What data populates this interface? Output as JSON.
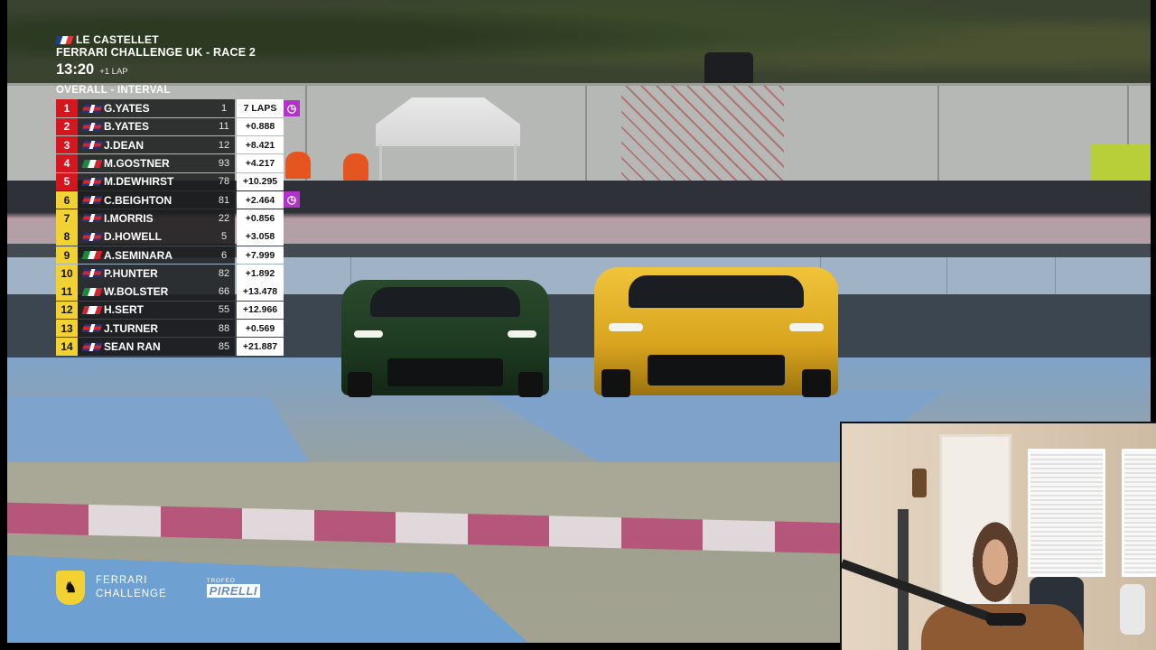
{
  "broadcast": {
    "venue": "LE CASTELLET",
    "series": "FERRARI CHALLENGE UK - RACE 2",
    "clock": "13:20",
    "laps_note": "+1 LAP",
    "mode": "OVERALL - INTERVAL"
  },
  "standings": [
    {
      "pos": "1",
      "driver": "G.YATES",
      "number": "1",
      "gap": "7 LAPS",
      "flag": "gb",
      "pos_color": "red",
      "fastest": true
    },
    {
      "pos": "2",
      "driver": "B.YATES",
      "number": "11",
      "gap": "+0.888",
      "flag": "gb",
      "pos_color": "red",
      "fastest": false
    },
    {
      "pos": "3",
      "driver": "J.DEAN",
      "number": "12",
      "gap": "+8.421",
      "flag": "gb",
      "pos_color": "red",
      "fastest": false
    },
    {
      "pos": "4",
      "driver": "M.GOSTNER",
      "number": "93",
      "gap": "+4.217",
      "flag": "it",
      "pos_color": "red",
      "fastest": false
    },
    {
      "pos": "5",
      "driver": "M.DEWHIRST",
      "number": "78",
      "gap": "+10.295",
      "flag": "gb",
      "pos_color": "red",
      "fastest": false
    },
    {
      "pos": "6",
      "driver": "C.BEIGHTON",
      "number": "81",
      "gap": "+2.464",
      "flag": "gb",
      "pos_color": "yellow",
      "fastest": true
    },
    {
      "pos": "7",
      "driver": "I.MORRIS",
      "number": "22",
      "gap": "+0.856",
      "flag": "gb",
      "pos_color": "yellow",
      "fastest": false
    },
    {
      "pos": "8",
      "driver": "D.HOWELL",
      "number": "5",
      "gap": "+3.058",
      "flag": "gb",
      "pos_color": "yellow",
      "fastest": false
    },
    {
      "pos": "9",
      "driver": "A.SEMINARA",
      "number": "6",
      "gap": "+7.999",
      "flag": "it",
      "pos_color": "yellow",
      "fastest": false
    },
    {
      "pos": "10",
      "driver": "P.HUNTER",
      "number": "82",
      "gap": "+1.892",
      "flag": "gb",
      "pos_color": "yellow",
      "fastest": false
    },
    {
      "pos": "11",
      "driver": "W.BOLSTER",
      "number": "66",
      "gap": "+13.478",
      "flag": "it",
      "pos_color": "yellow",
      "fastest": false
    },
    {
      "pos": "12",
      "driver": "H.SERT",
      "number": "55",
      "gap": "+12.966",
      "flag": "ca",
      "pos_color": "yellow",
      "fastest": false
    },
    {
      "pos": "13",
      "driver": "J.TURNER",
      "number": "88",
      "gap": "+0.569",
      "flag": "gb",
      "pos_color": "yellow",
      "fastest": false
    },
    {
      "pos": "14",
      "driver": "SEAN RAN",
      "number": "85",
      "gap": "+21.887",
      "flag": "gb",
      "pos_color": "yellow",
      "fastest": false
    }
  ],
  "fastest_icon": "stopwatch-icon",
  "logos": {
    "ferrari_line1": "FERRARI",
    "ferrari_line2": "CHALLENGE",
    "pirelli_small": "TROFEO",
    "pirelli_big": "PIRELLI"
  },
  "colors": {
    "pos_red": "#d4171f",
    "pos_yellow": "#f2d232",
    "fastest_purple": "#b233c9"
  }
}
